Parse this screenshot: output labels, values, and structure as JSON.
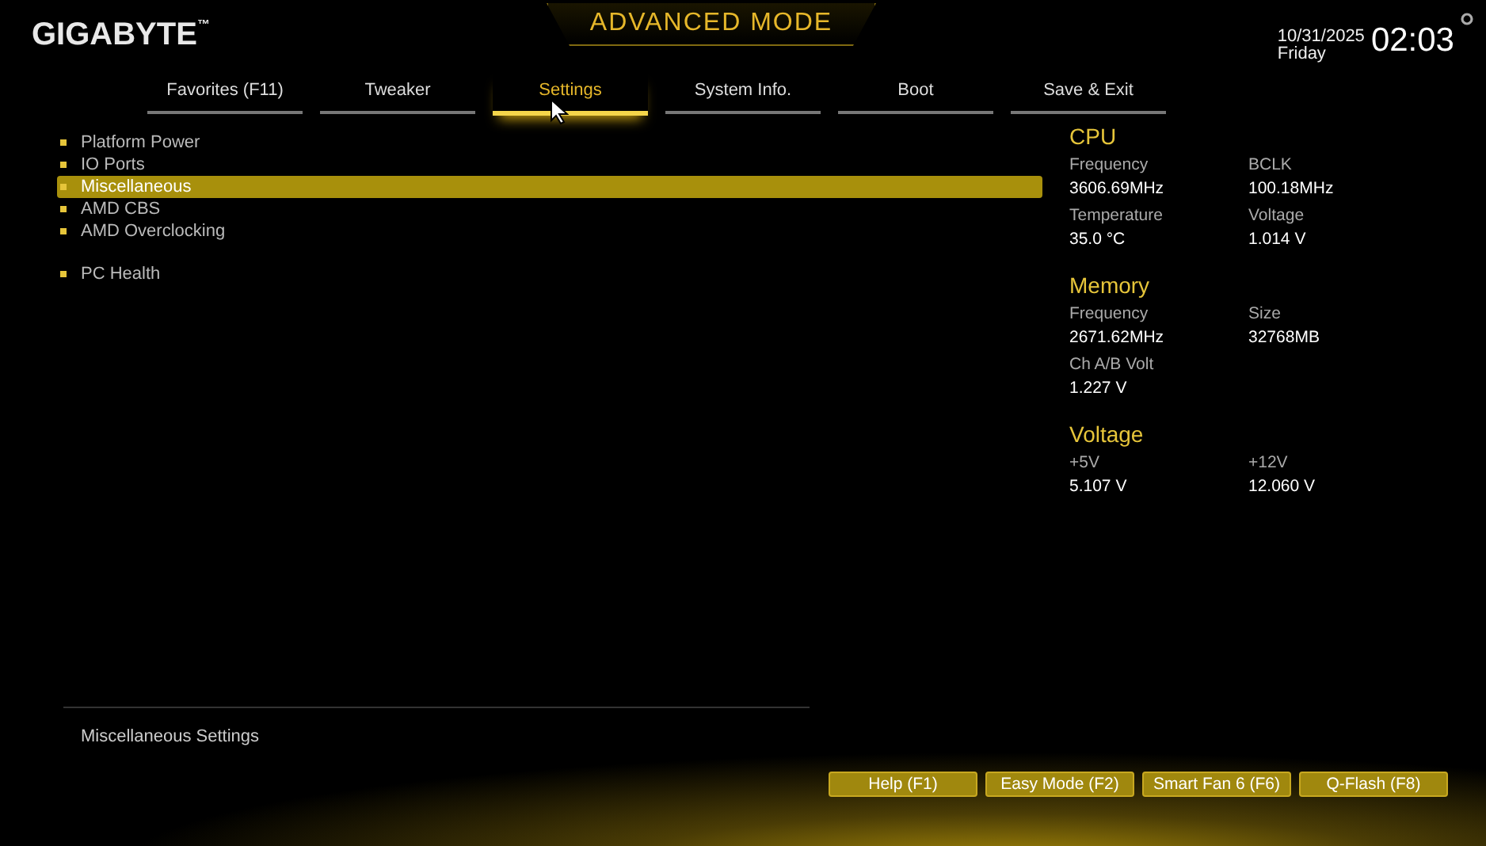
{
  "header": {
    "logo": "GIGABYTE",
    "logo_mark": "™",
    "mode": "ADVANCED MODE",
    "date": "10/31/2025",
    "day": "Friday",
    "time": "02:03"
  },
  "tabs": [
    {
      "label": "Favorites (F11)",
      "selected": false
    },
    {
      "label": "Tweaker",
      "selected": false
    },
    {
      "label": "Settings",
      "selected": true
    },
    {
      "label": "System Info.",
      "selected": false
    },
    {
      "label": "Boot",
      "selected": false
    },
    {
      "label": "Save & Exit",
      "selected": false
    }
  ],
  "menu": {
    "groups": [
      [
        {
          "label": "Platform Power",
          "selected": false
        },
        {
          "label": "IO Ports",
          "selected": false
        },
        {
          "label": "Miscellaneous",
          "selected": true
        },
        {
          "label": "AMD CBS",
          "selected": false
        },
        {
          "label": "AMD Overclocking",
          "selected": false
        }
      ],
      [
        {
          "label": "PC Health",
          "selected": false
        }
      ]
    ]
  },
  "monitor": [
    {
      "title": "CPU",
      "fields": [
        {
          "label": "Frequency",
          "value": "3606.69MHz"
        },
        {
          "label": "BCLK",
          "value": "100.18MHz"
        },
        {
          "label": "Temperature",
          "value": "35.0 °C"
        },
        {
          "label": "Voltage",
          "value": "1.014 V"
        }
      ]
    },
    {
      "title": "Memory",
      "fields": [
        {
          "label": "Frequency",
          "value": "2671.62MHz"
        },
        {
          "label": "Size",
          "value": "32768MB"
        },
        {
          "label": "Ch A/B Volt",
          "value": "1.227 V"
        }
      ]
    },
    {
      "title": "Voltage",
      "fields": [
        {
          "label": "+5V",
          "value": "5.107 V"
        },
        {
          "label": "+12V",
          "value": "12.060 V"
        }
      ]
    }
  ],
  "help_text": "Miscellaneous Settings",
  "buttons": [
    "Help (F1)",
    "Easy Mode (F2)",
    "Smart Fan 6 (F6)",
    "Q-Flash (F8)"
  ]
}
